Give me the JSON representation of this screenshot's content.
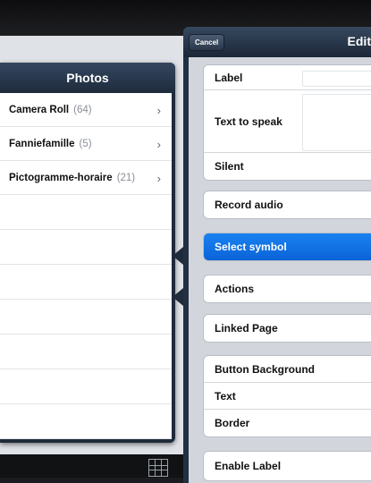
{
  "photos": {
    "title": "Photos",
    "albums": [
      {
        "name": "Camera Roll",
        "count": "(64)"
      },
      {
        "name": "Fanniefamille",
        "count": "(5)"
      },
      {
        "name": "Pictogramme-horaire",
        "count": "(21)"
      }
    ]
  },
  "edit": {
    "cancel_label": "Cancel",
    "title": "Edit",
    "rows": {
      "label": "Label",
      "text_to_speak": "Text to speak",
      "silent": "Silent",
      "record_audio": "Record audio",
      "select_symbol": "Select symbol",
      "actions": "Actions",
      "linked_page": "Linked Page",
      "button_background": "Button Background",
      "text": "Text",
      "border": "Border",
      "enable_label": "Enable Label"
    }
  },
  "colors": {
    "selected_row": "#0b63d8",
    "popover_frame": "#1f2a3a"
  },
  "icons": {
    "grid": "grid-icon",
    "chevron": "chevron-right-icon"
  }
}
